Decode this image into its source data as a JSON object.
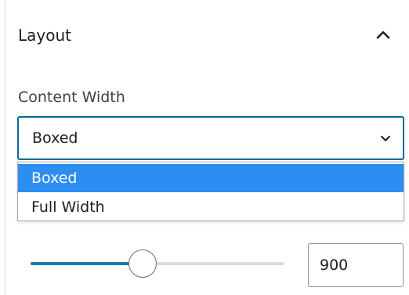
{
  "panel": {
    "title": "Layout",
    "collapse_icon": "chevron-up-icon"
  },
  "content_width": {
    "label": "Content Width",
    "selected_value": "Boxed",
    "select_icon": "chevron-down-icon",
    "options": [
      {
        "label": "Boxed",
        "selected": true
      },
      {
        "label": "Full Width",
        "selected": false
      }
    ]
  },
  "width_control": {
    "slider_fraction": 0.44,
    "value": "900"
  },
  "colors": {
    "accent": "#2b8ef0",
    "focus_border": "#0a6b98",
    "slider_fill": "#1a7bb4"
  }
}
